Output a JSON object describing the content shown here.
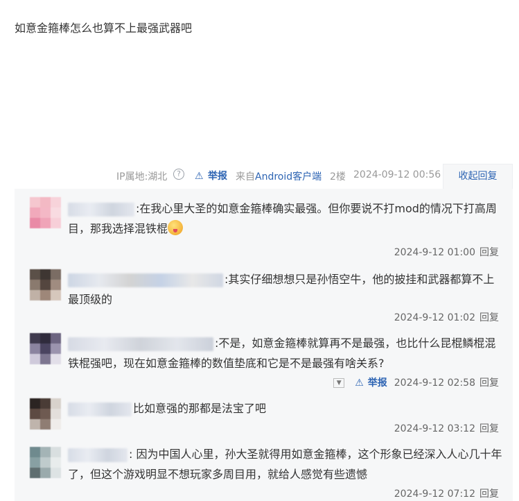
{
  "post": {
    "body": "如意金箍棒怎么也算不上最强武器吧"
  },
  "tail": {
    "ip": "IP属地:湖北",
    "help_glyph": "?",
    "report": "举报",
    "from_prefix": "来自",
    "device": "Android客户端",
    "floor": "2楼",
    "date": "2024-09-12 00:56",
    "collapse": "收起回复"
  },
  "replies": [
    {
      "text": ":在我心里大圣的如意金箍棒确实最强。但你要说不打mod的情况下打高周目，那我选择混铁棍",
      "time": "2024-9-12 01:00",
      "action": "回复"
    },
    {
      "text": ":其实仔细想想只是孙悟空牛，他的披挂和武器都算不上最顶级的",
      "time": "2024-9-12 01:02",
      "action": "回复"
    },
    {
      "text": ":不是，如意金箍棒就算再不是最强，也比什么昆棍鳞棍混铁棍强吧，现在如意金箍棒的数值垫底和它是不是最强有啥关系?",
      "time": "2024-9-12 02:58",
      "action": "回复",
      "report": "举报"
    },
    {
      "text": "比如意强的那都是法宝了吧",
      "time": "2024-9-12 03:12",
      "action": "回复"
    },
    {
      "text": ": 因为中国人心里，孙大圣就得用如意金箍棒，这个形象已经深入人心几十年了，但这个游戏明显不想玩家多周目用，就给人感觉有些遗憾",
      "time": "2024-9-12 07:12",
      "action": "回复"
    }
  ],
  "icons": {
    "help": "question-circle-icon",
    "warn": "warning-triangle-icon",
    "dropdown": "chevron-down-icon",
    "emoji": "smiley-tongue-emoji-icon"
  },
  "colors": {
    "link": "#2d64b3",
    "muted": "#999999",
    "reply_bg": "#f6f7f8"
  }
}
